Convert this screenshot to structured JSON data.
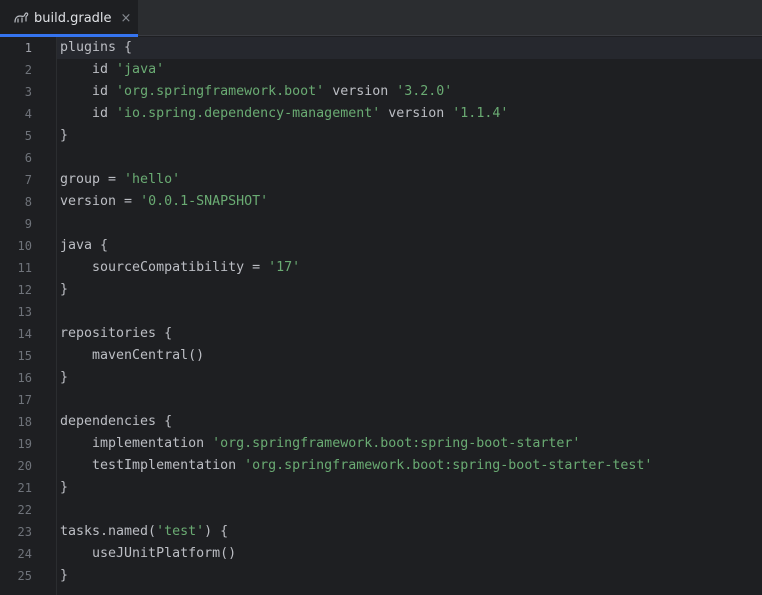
{
  "tab": {
    "label": "build.gradle",
    "icon": "gradle-elephant-icon",
    "close_glyph": "×"
  },
  "colors": {
    "background": "#1e1f22",
    "tabbar": "#2b2d30",
    "accent": "#3574f0",
    "plain": "#bcbec4",
    "string": "#6aab73",
    "line_number": "#6f737a"
  },
  "editor": {
    "active_line": 1,
    "lines": [
      {
        "n": "1",
        "tokens": [
          {
            "t": "plugins {",
            "k": "plain"
          }
        ]
      },
      {
        "n": "2",
        "tokens": [
          {
            "t": "    id ",
            "k": "plain"
          },
          {
            "t": "'java'",
            "k": "str"
          }
        ]
      },
      {
        "n": "3",
        "tokens": [
          {
            "t": "    id ",
            "k": "plain"
          },
          {
            "t": "'org.springframework.boot'",
            "k": "str"
          },
          {
            "t": " version ",
            "k": "plain"
          },
          {
            "t": "'3.2.0'",
            "k": "str"
          }
        ]
      },
      {
        "n": "4",
        "tokens": [
          {
            "t": "    id ",
            "k": "plain"
          },
          {
            "t": "'io.spring.dependency-management'",
            "k": "str"
          },
          {
            "t": " version ",
            "k": "plain"
          },
          {
            "t": "'1.1.4'",
            "k": "str"
          }
        ]
      },
      {
        "n": "5",
        "tokens": [
          {
            "t": "}",
            "k": "plain"
          }
        ]
      },
      {
        "n": "6",
        "tokens": []
      },
      {
        "n": "7",
        "tokens": [
          {
            "t": "group = ",
            "k": "plain"
          },
          {
            "t": "'hello'",
            "k": "str"
          }
        ]
      },
      {
        "n": "8",
        "tokens": [
          {
            "t": "version = ",
            "k": "plain"
          },
          {
            "t": "'0.0.1-SNAPSHOT'",
            "k": "str"
          }
        ]
      },
      {
        "n": "9",
        "tokens": []
      },
      {
        "n": "10",
        "tokens": [
          {
            "t": "java {",
            "k": "plain"
          }
        ]
      },
      {
        "n": "11",
        "tokens": [
          {
            "t": "    sourceCompatibility = ",
            "k": "plain"
          },
          {
            "t": "'17'",
            "k": "str"
          }
        ]
      },
      {
        "n": "12",
        "tokens": [
          {
            "t": "}",
            "k": "plain"
          }
        ]
      },
      {
        "n": "13",
        "tokens": []
      },
      {
        "n": "14",
        "tokens": [
          {
            "t": "repositories {",
            "k": "plain"
          }
        ]
      },
      {
        "n": "15",
        "tokens": [
          {
            "t": "    mavenCentral()",
            "k": "plain"
          }
        ]
      },
      {
        "n": "16",
        "tokens": [
          {
            "t": "}",
            "k": "plain"
          }
        ]
      },
      {
        "n": "17",
        "tokens": []
      },
      {
        "n": "18",
        "tokens": [
          {
            "t": "dependencies {",
            "k": "plain"
          }
        ]
      },
      {
        "n": "19",
        "tokens": [
          {
            "t": "    implementation ",
            "k": "plain"
          },
          {
            "t": "'org.springframework.boot:spring-boot-starter'",
            "k": "str"
          }
        ]
      },
      {
        "n": "20",
        "tokens": [
          {
            "t": "    testImplementation ",
            "k": "plain"
          },
          {
            "t": "'org.springframework.boot:spring-boot-starter-test'",
            "k": "str"
          }
        ]
      },
      {
        "n": "21",
        "tokens": [
          {
            "t": "}",
            "k": "plain"
          }
        ]
      },
      {
        "n": "22",
        "tokens": []
      },
      {
        "n": "23",
        "tokens": [
          {
            "t": "tasks.named(",
            "k": "plain"
          },
          {
            "t": "'test'",
            "k": "str"
          },
          {
            "t": ") {",
            "k": "plain"
          }
        ]
      },
      {
        "n": "24",
        "tokens": [
          {
            "t": "    useJUnitPlatform()",
            "k": "plain"
          }
        ]
      },
      {
        "n": "25",
        "tokens": [
          {
            "t": "}",
            "k": "plain"
          }
        ]
      }
    ]
  }
}
